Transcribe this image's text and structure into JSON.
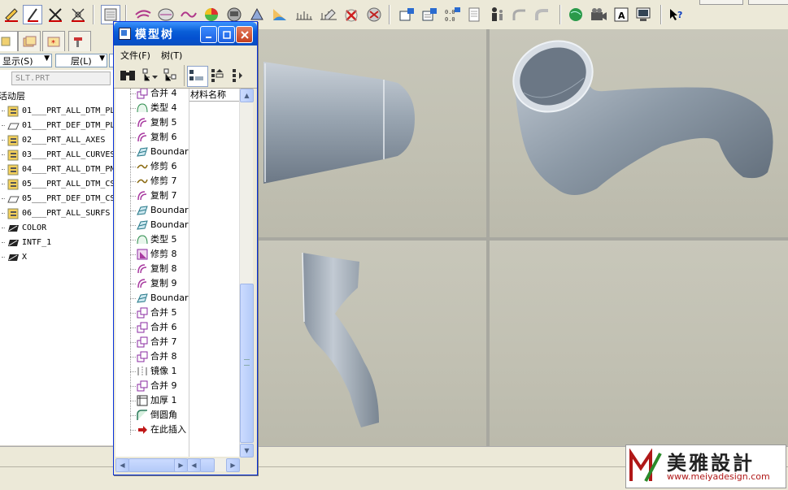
{
  "toolbar": {
    "icons": [
      "sketch-icon",
      "pen-icon",
      "plane-icon",
      "axis-icon",
      "view-icon",
      "style-icon",
      "datum-icon",
      "curve-icon",
      "color-icon",
      "render-icon",
      "appearance-icon",
      "shading-icon",
      "graph-icon",
      "edit-icon",
      "delete-icon",
      "regen-icon",
      "component-icon",
      "assembly-icon",
      "coord-icon",
      "doc-icon",
      "person-icon",
      "spline-icon",
      "pipe-icon",
      "globe-icon",
      "camera-icon",
      "letter-a-icon",
      "monitor-icon",
      "help-icon"
    ]
  },
  "left_panel": {
    "tabs": [
      "model-tree-tab",
      "folder-tab",
      "favorites-tab",
      "tool-tab"
    ],
    "show_dropdown": "显示(S)",
    "layer_dropdown": "层(L)",
    "filter_text": "SLT.PRT",
    "header": "活动层",
    "layers": [
      "01___PRT_ALL_DTM_PL",
      "01___PRT_DEF_DTM_PL",
      "02___PRT_ALL_AXES",
      "03___PRT_ALL_CURVES",
      "04___PRT_ALL_DTM_PN",
      "05___PRT_ALL_DTM_CS",
      "05___PRT_DEF_DTM_CS",
      "06___PRT_ALL_SURFS",
      "COLOR",
      "INTF_1",
      "X"
    ]
  },
  "model_tree": {
    "title": "模型树",
    "menu": [
      "文件(F)",
      "树(T)"
    ],
    "column_header": "材料名称",
    "items": [
      {
        "label": "合并 4",
        "icon": "merge"
      },
      {
        "label": "类型 4",
        "icon": "type"
      },
      {
        "label": "复制 5",
        "icon": "copy"
      },
      {
        "label": "复制 6",
        "icon": "copy"
      },
      {
        "label": "Boundar",
        "icon": "boundary"
      },
      {
        "label": "修剪 6",
        "icon": "trim"
      },
      {
        "label": "修剪 7",
        "icon": "trim"
      },
      {
        "label": "复制 7",
        "icon": "copy"
      },
      {
        "label": "Boundar",
        "icon": "boundary"
      },
      {
        "label": "Boundar",
        "icon": "boundary"
      },
      {
        "label": "类型 5",
        "icon": "type"
      },
      {
        "label": "修剪 8",
        "icon": "trim-surface"
      },
      {
        "label": "复制 8",
        "icon": "copy"
      },
      {
        "label": "复制 9",
        "icon": "copy"
      },
      {
        "label": "Boundar",
        "icon": "boundary"
      },
      {
        "label": "合并 5",
        "icon": "merge"
      },
      {
        "label": "合并 6",
        "icon": "merge"
      },
      {
        "label": "合并 7",
        "icon": "merge"
      },
      {
        "label": "合并 8",
        "icon": "merge"
      },
      {
        "label": "镜像 1",
        "icon": "mirror"
      },
      {
        "label": "合并 9",
        "icon": "merge"
      },
      {
        "label": "加厚 1",
        "icon": "thicken"
      },
      {
        "label": "倒圆角",
        "icon": "round"
      },
      {
        "label": "在此插入",
        "icon": "insert-arrow"
      }
    ]
  },
  "watermark": {
    "cn": "美雅設計",
    "url": "www.meiyadesign.com"
  }
}
